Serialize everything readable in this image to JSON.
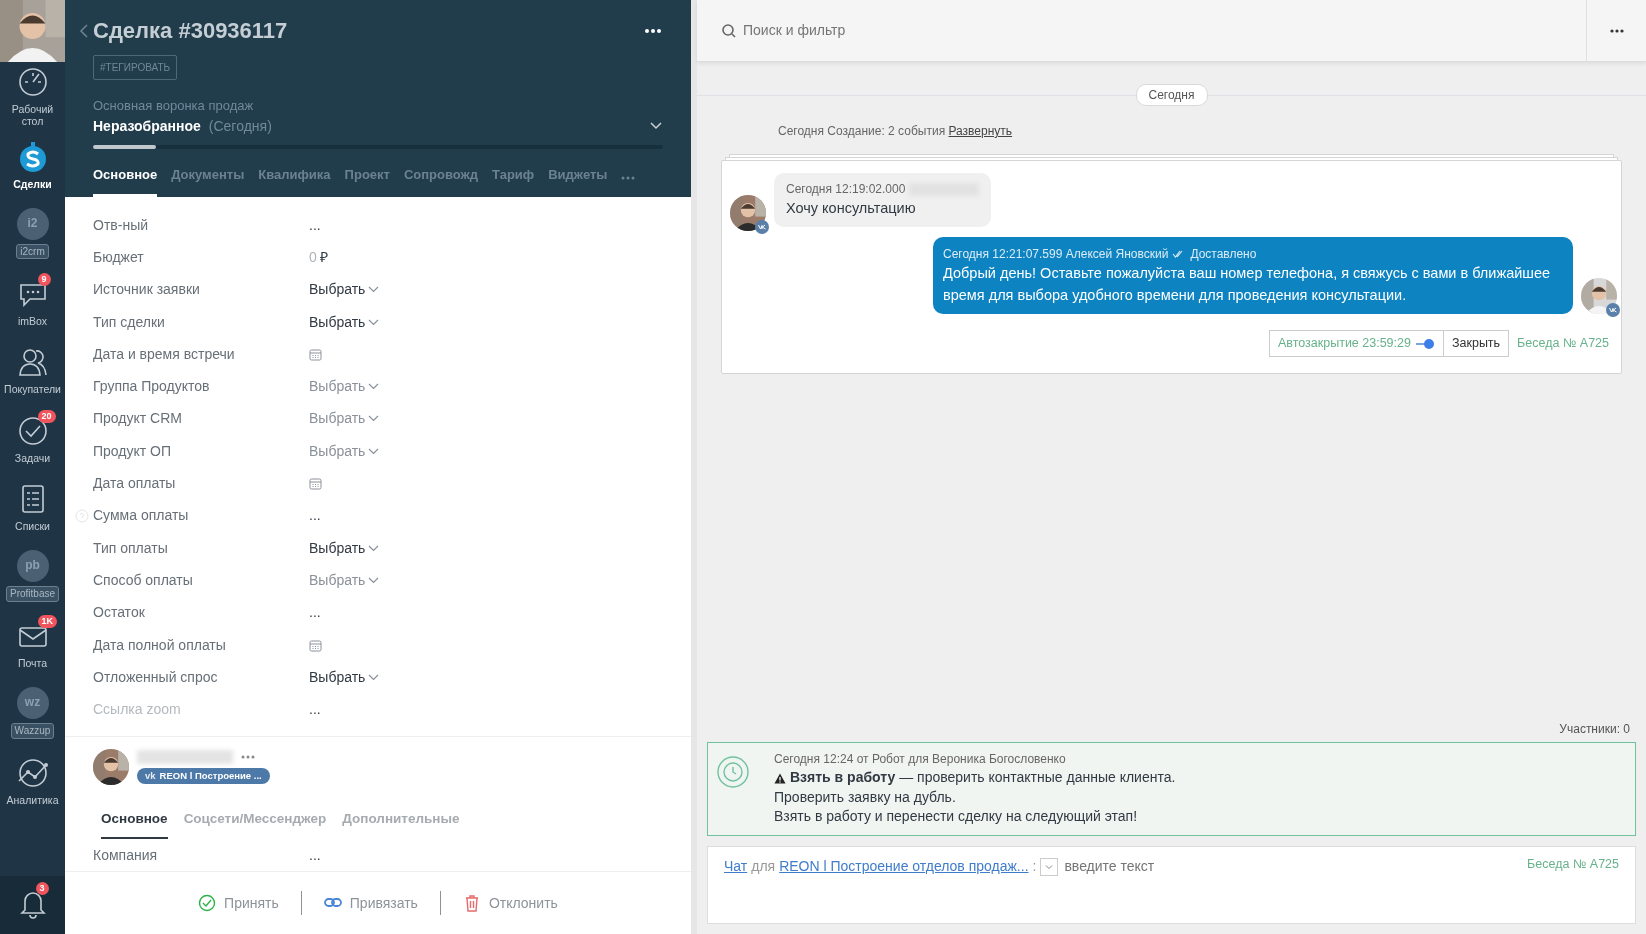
{
  "sidebar": {
    "items": [
      {
        "kind": "dashboard",
        "label": "Рабочий стол",
        "selected": false
      },
      {
        "kind": "deals",
        "label": "Сделки",
        "selected": true
      },
      {
        "kind": "widget",
        "logo": "i2",
        "label": "i2crm",
        "selected": false
      },
      {
        "kind": "chat",
        "label": "imBox",
        "badge": "9",
        "selected": false
      },
      {
        "kind": "people",
        "label": "Покупатели",
        "selected": false
      },
      {
        "kind": "tasks",
        "label": "Задачи",
        "badge": "20",
        "selected": false
      },
      {
        "kind": "lists",
        "label": "Списки",
        "selected": false
      },
      {
        "kind": "widget",
        "logo": "pb",
        "label": "Profitbase",
        "selected": false
      },
      {
        "kind": "mail",
        "label": "Почта",
        "badge": "1K",
        "selected": false
      },
      {
        "kind": "widget",
        "logo": "wz",
        "label": "Wazzup",
        "selected": false
      },
      {
        "kind": "analytics",
        "label": "Аналитика",
        "selected": false
      }
    ],
    "notifications": {
      "badge": "3"
    }
  },
  "deal": {
    "title": "Сделка #30936117",
    "tag_button": "#ТЕГИРОВАТЬ",
    "pipeline": "Основная воронка продаж",
    "stage": "Неразобранное",
    "stage_date": "(Сегодня)",
    "stage_progress": {
      "level": 0.11
    },
    "tabs": [
      {
        "label": "Основное",
        "selected": true
      },
      {
        "label": "Документы",
        "selected": false
      },
      {
        "label": "Квалифика",
        "selected": false
      },
      {
        "label": "Проект",
        "selected": false
      },
      {
        "label": "Сопровожд",
        "selected": false
      },
      {
        "label": "Тариф",
        "selected": false
      },
      {
        "label": "Виджеты",
        "selected": false
      }
    ],
    "fields": [
      {
        "label": "Отв-ный",
        "kind": "text",
        "value": "...",
        "muted": false,
        "label_muted": false,
        "help": false
      },
      {
        "label": "Бюджет",
        "kind": "money",
        "value": "0",
        "currency": "₽",
        "muted": false,
        "label_muted": false,
        "help": false
      },
      {
        "label": "Источник заявки",
        "kind": "select",
        "value": "Выбрать",
        "muted": false,
        "label_muted": false,
        "help": false
      },
      {
        "label": "Тип сделки",
        "kind": "select",
        "value": "Выбрать",
        "muted": false,
        "label_muted": false,
        "help": false
      },
      {
        "label": "Дата и время встречи",
        "kind": "date",
        "muted": false,
        "label_muted": false,
        "help": false
      },
      {
        "label": "Группа Продуктов",
        "kind": "select",
        "value": "Выбрать",
        "muted": true,
        "label_muted": false,
        "help": false
      },
      {
        "label": "Продукт CRM",
        "kind": "select",
        "value": "Выбрать",
        "muted": true,
        "label_muted": false,
        "help": false
      },
      {
        "label": "Продукт ОП",
        "kind": "select",
        "value": "Выбрать",
        "muted": true,
        "label_muted": false,
        "help": false
      },
      {
        "label": "Дата оплаты",
        "kind": "date",
        "muted": false,
        "label_muted": false,
        "help": false
      },
      {
        "label": "Сумма оплаты",
        "kind": "text",
        "value": "...",
        "muted": false,
        "label_muted": false,
        "help": true
      },
      {
        "label": "Тип оплаты",
        "kind": "select",
        "value": "Выбрать",
        "muted": false,
        "label_muted": false,
        "help": false
      },
      {
        "label": "Способ оплаты",
        "kind": "select",
        "value": "Выбрать",
        "muted": true,
        "label_muted": false,
        "help": false
      },
      {
        "label": "Остаток",
        "kind": "text",
        "value": "...",
        "muted": false,
        "label_muted": false,
        "help": false
      },
      {
        "label": "Дата полной оплаты",
        "kind": "date",
        "muted": false,
        "label_muted": false,
        "help": false
      },
      {
        "label": "Отложенный спрос",
        "kind": "select",
        "value": "Выбрать",
        "muted": false,
        "label_muted": false,
        "help": false
      },
      {
        "label": "Ссылка zoom",
        "kind": "text",
        "value": "...",
        "muted": false,
        "label_muted": true,
        "help": false
      }
    ]
  },
  "contact": {
    "tag_logo": "vk",
    "tag": "REON l Построение ...",
    "tabs": [
      {
        "label": "Основное",
        "selected": true
      },
      {
        "label": "Соцсети/Мессенджер",
        "selected": false
      },
      {
        "label": "Дополнительные",
        "selected": false
      }
    ],
    "fields": [
      {
        "label": "Компания",
        "value": "..."
      }
    ]
  },
  "actions": [
    {
      "kind": "accept",
      "label": "Принять"
    },
    {
      "kind": "link",
      "label": "Привязать"
    },
    {
      "kind": "decline",
      "label": "Отклонить"
    }
  ],
  "chat": {
    "search": {
      "placeholder": "Поиск и фильтр"
    },
    "date_divider": "Сегодня",
    "event": {
      "text": "Сегодня Создание: 2 события",
      "link": "Развернуть"
    },
    "messages": [
      {
        "kind": "incoming",
        "meta": "Сегодня 12:19:02.000",
        "text": "Хочу консультацию"
      },
      {
        "kind": "outgoing",
        "meta": "Сегодня 12:21:07.599 Алексей Яновский",
        "status": "Доставлено",
        "text": "Добрый день! Оставьте пожалуйста ваш номер телефона, я свяжусь с вами в ближайшее время для выбора удобного времени для проведения консультации."
      }
    ],
    "autoclose": {
      "label": "Автозакрытие 23:59:29",
      "on": true
    },
    "close_button": "Закрыть",
    "conversation": "Беседа № A725",
    "participants": "Участники: 0",
    "task": {
      "meta": "Сегодня 12:24 от Робот для Вероника Богословенко",
      "lines": [
        "**Взять в работу** — проверить контактные данные клиента.",
        "Проверить заявку на дубль.",
        "Взять в работу и перенести сделку на следующий этап!"
      ]
    },
    "composer": {
      "chat_link": "Чат",
      "for": "для",
      "target_link": "REON l Построение отделов продаж...",
      "colon": ":",
      "placeholder": "введите текст",
      "conversation": "Беседа № A725"
    }
  }
}
